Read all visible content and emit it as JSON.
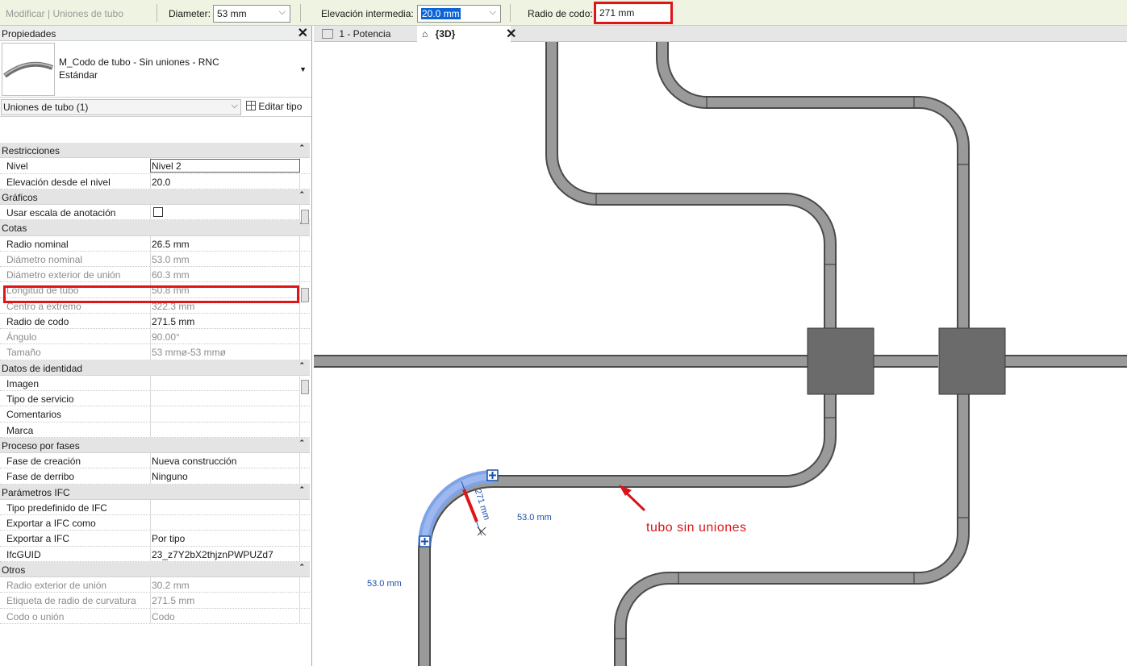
{
  "options_bar": {
    "context_label": "Modificar | Uniones de tubo",
    "diameter_label": "Diameter:",
    "diameter_value": "53 mm",
    "mid_elevation_label": "Elevación intermedia:",
    "mid_elevation_value": "20.0 mm",
    "bend_radius_label": "Radio de codo:",
    "bend_radius_value": "271 mm"
  },
  "properties": {
    "title": "Propiedades",
    "type_name": "M_Codo de tubo - Sin uniones - RNC",
    "type_sub": "Estándar",
    "instance_selector": "Uniones de tubo (1)",
    "edit_type_label": "Editar tipo",
    "groups": [
      {
        "label": "Restricciones",
        "rows": [
          {
            "key": "Nivel",
            "value": "Nivel 2"
          },
          {
            "key": "Elevación desde el nivel",
            "value": "20.0"
          }
        ]
      },
      {
        "label": "Gráficos",
        "rows": [
          {
            "key": "Usar escala de anotación",
            "value": ""
          }
        ]
      },
      {
        "label": "Cotas",
        "rows": [
          {
            "key": "Radio nominal",
            "value": "26.5 mm"
          },
          {
            "key": "Diámetro nominal",
            "value": "53.0 mm"
          },
          {
            "key": "Diámetro exterior de unión",
            "value": "60.3 mm"
          },
          {
            "key": "Longitud de tubo",
            "value": "50.8 mm"
          },
          {
            "key": "Centro a extremo",
            "value": "322.3 mm"
          },
          {
            "key": "Radio de codo",
            "value": "271.5 mm"
          },
          {
            "key": "Ángulo",
            "value": "90.00°"
          },
          {
            "key": "Tamaño",
            "value": "53 mmø-53 mmø"
          }
        ]
      },
      {
        "label": "Datos de identidad",
        "rows": [
          {
            "key": "Imagen",
            "value": ""
          },
          {
            "key": "Tipo de servicio",
            "value": ""
          },
          {
            "key": "Comentarios",
            "value": ""
          },
          {
            "key": "Marca",
            "value": ""
          }
        ]
      },
      {
        "label": "Proceso por fases",
        "rows": [
          {
            "key": "Fase de creación",
            "value": "Nueva construcción"
          },
          {
            "key": "Fase de derribo",
            "value": "Ninguno"
          }
        ]
      },
      {
        "label": "Parámetros IFC",
        "rows": [
          {
            "key": "Tipo predefinido de IFC",
            "value": ""
          },
          {
            "key": "Exportar a IFC como",
            "value": ""
          },
          {
            "key": "Exportar a IFC",
            "value": "Por tipo"
          },
          {
            "key": "IfcGUID",
            "value": "23_z7Y2bX2thjznPWPUZd7"
          }
        ]
      },
      {
        "label": "Otros",
        "rows": [
          {
            "key": "Radio exterior de unión",
            "value": "30.2 mm"
          },
          {
            "key": "Etiqueta de radio de curvatura",
            "value": "271.5 mm"
          },
          {
            "key": "Codo o unión",
            "value": "Codo"
          }
        ]
      }
    ]
  },
  "tabs": [
    {
      "label": "1 - Potencia"
    },
    {
      "label": "{3D}"
    }
  ],
  "viewport": {
    "dim_label_1": "53.0 mm",
    "dim_label_2": "53.0 mm",
    "radius_dim": "271 mm",
    "annotation": "tubo sin uniones"
  },
  "colors": {
    "highlight": "#e0151a",
    "selection": "#7fa3e8",
    "options_bar": "#eef3e2"
  }
}
